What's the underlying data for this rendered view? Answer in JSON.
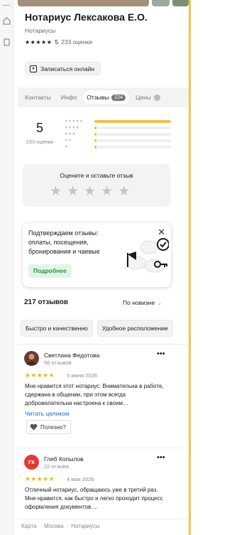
{
  "rail": {
    "icons": [
      "rail-icon-top",
      "home-icon",
      "rail-icon-bottom"
    ]
  },
  "business": {
    "name": "Нотариус Лексакова Е.О.",
    "category": "Нотариусы",
    "rating": "5",
    "rating_stars": "★★★★★",
    "ratings_count": "233 оценки",
    "book_label": "Записаться онлайн"
  },
  "tabs": [
    {
      "label": "Контакты"
    },
    {
      "label": "Инфо"
    },
    {
      "label": "Отзывы",
      "badge": "224",
      "active": true
    },
    {
      "label": "Цены"
    }
  ],
  "summary": {
    "rating": "5",
    "count": "233 оценки",
    "distribution": [
      {
        "stars": "★★★★★",
        "share": 1.0
      },
      {
        "stars": "★★★★",
        "share": 0.01
      },
      {
        "stars": "★★★",
        "share": 0.01
      },
      {
        "stars": "★★",
        "share": 0.01
      },
      {
        "stars": "★",
        "share": 0.01
      }
    ]
  },
  "rate_box": {
    "label": "Оцените и оставьте отзыв",
    "stars": "★★★★★"
  },
  "promo": {
    "text": "Подтверждаем отзывы: оплаты, посещения, бронирования и чаевые",
    "button": "Подробнее",
    "close": "✕"
  },
  "reviews_header": {
    "count": "217 отзывов",
    "sort": "По новизне"
  },
  "chips": [
    "Быстро и качественно",
    "Удобное расположение"
  ],
  "reviews": [
    {
      "name": "Светлана Федотова",
      "level": "56 отзывов",
      "stars": "★★★★★",
      "date": "5 июня 2026",
      "text": "Мне нравится этот нотариус. Внимательна в работе, сдержана в общении, при этом всегда доброжелательна настроена к своим…",
      "read_all": "Читать целиком",
      "useful": "Полезно?",
      "avatar_color": "#6b3a2a"
    },
    {
      "name": "Глеб Копылов",
      "level": "22 отзыва",
      "initials": "ГК",
      "stars": "★★★★★",
      "date": "4 мая 2026",
      "text": "Отличный нотариус, обращаюсь уже в третий раз. Мне нравится, как быстро и легко проходит процесс оформления документов.…",
      "avatar_color": "#e53935"
    }
  ],
  "footer": [
    "Карта",
    "·",
    "Москва",
    "·",
    "Нотариусы"
  ],
  "colors": {
    "accent_yellow": "#f7c12e",
    "star_yellow": "#f7b500",
    "link_blue": "#1a66d6",
    "green": "#1d9a3b"
  }
}
